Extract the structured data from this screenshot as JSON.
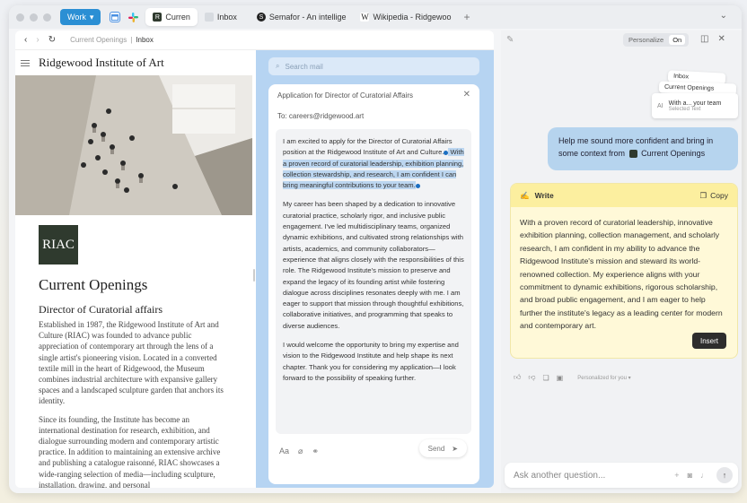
{
  "tabbar": {
    "workspace_label": "Work",
    "tabs": [
      {
        "label": "Curren",
        "active": true
      },
      {
        "label": "Inbox",
        "active": false
      },
      {
        "label": "Semafor - An intellige",
        "active": false
      },
      {
        "label": "Wikipedia - Ridgewoo",
        "active": false
      }
    ],
    "new_tab": "+"
  },
  "navbar": {
    "breadcrumb_parent": "Current Openings",
    "breadcrumb_separator": "|",
    "breadcrumb_current": "Inbox"
  },
  "site": {
    "name": "Ridgewood Institute of Art",
    "logo_text": "RIAC",
    "heading": "Current Openings",
    "subheading": "Director of Curatorial affairs",
    "paragraphs": [
      "Established in 1987, the Ridgewood Institute of Art and Culture (RIAC) was founded to advance public appreciation of contemporary art through the lens of a single artist's pioneering vision. Located in a converted textile mill in the heart of Ridgewood, the Museum combines industrial architecture with expansive gallery spaces and a landscaped sculpture garden that anchors its identity.",
      "Since its founding, the Institute has become an international destination for research, exhibition, and dialogue surrounding modern and contemporary artistic practice. In addition to maintaining an extensive archive and publishing a catalogue raisonné, RIAC showcases a wide-ranging selection of media—including sculpture, installation, drawing, and personal"
    ]
  },
  "mail": {
    "search_placeholder": "Search mail",
    "compose_title": "Application for Director of Curatorial Affairs",
    "to_line": "To: careers@ridgewood.art",
    "body": {
      "p1_before": "I am excited to apply for the Director of Curatorial Affairs position at the Ridgewood Institute of Art and Culture.",
      "p1_selected": " With a proven record of curatorial leadership, exhibition planning, collection stewardship, and research, I am confident I can bring meaningful contributions to your team.",
      "p2": "My career has been shaped by a dedication to innovative curatorial practice, scholarly rigor, and inclusive public engagement. I've led multidisciplinary teams, organized dynamic exhibitions, and cultivated strong relationships with artists, academics, and community collaborators—experience that aligns closely with the responsibilities of this role. The Ridgewood Institute's mission to preserve and expand the legacy of its founding artist while fostering dialogue across disciplines resonates deeply with me. I am eager to support that mission through thoughtful exhibitions, collaborative initiatives, and programming that speaks to diverse audiences.",
      "p3": "I would welcome the opportunity to bring my expertise and vision to the Ridgewood Institute and help shape its next chapter. Thank you for considering my application—I look forward to the possibility of speaking further."
    },
    "send_label": "Send",
    "format_label": "Aa"
  },
  "assistant": {
    "personalize_label": "Personalize",
    "personalize_state": "On",
    "context_cards": [
      {
        "label": "Inbox"
      },
      {
        "label": "Current Openings"
      },
      {
        "label": "With a... your team",
        "sublabel": "Selected Text",
        "icon_text": "AI"
      }
    ],
    "user_message": "Help me sound more confident and bring in some context from",
    "user_message_ref": "Current Openings",
    "write_title": "Write",
    "copy_label": "Copy",
    "write_text": "With a proven record of curatorial leadership, innovative exhibition planning, collection management, and scholarly research, I am confident in my ability to advance the Ridgewood Institute's mission and steward its world-renowned collection. My experience aligns with your commitment to dynamic exhibitions, rigorous scholarship, and broad public engagement, and I am eager to help further the institute's legacy as a leading center for modern and contemporary art.",
    "insert_label": "Insert",
    "personalized_label": "Personalized for you",
    "ask_placeholder": "Ask another question..."
  },
  "colors": {
    "accent": "#2b8fd4",
    "mail_bg": "#b6d4f2",
    "user_bubble": "#b6d4ee",
    "write_card": "#fff9d8",
    "write_header": "#fcef9f"
  }
}
